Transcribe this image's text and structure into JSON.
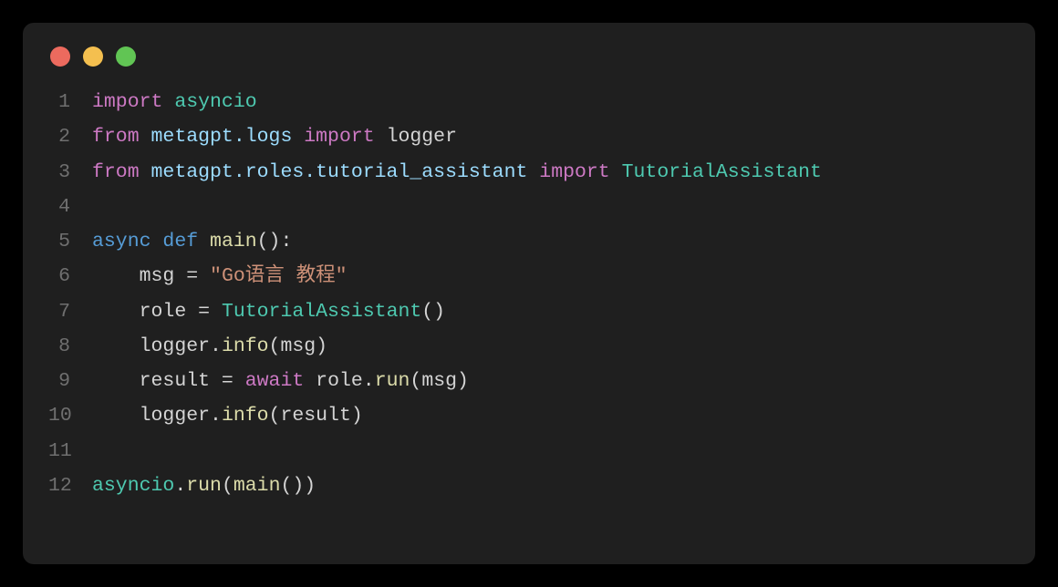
{
  "window": {
    "dots": [
      "red",
      "yellow",
      "green"
    ]
  },
  "code": {
    "language": "python",
    "lines": [
      {
        "num": "1",
        "tokens": [
          {
            "t": "import",
            "c": "c-kw1"
          },
          {
            "t": " ",
            "c": "c-op"
          },
          {
            "t": "asyncio",
            "c": "c-mod"
          }
        ]
      },
      {
        "num": "2",
        "tokens": [
          {
            "t": "from",
            "c": "c-kw1"
          },
          {
            "t": " ",
            "c": "c-op"
          },
          {
            "t": "metagpt.logs",
            "c": "c-mem"
          },
          {
            "t": " ",
            "c": "c-op"
          },
          {
            "t": "import",
            "c": "c-kw1"
          },
          {
            "t": " ",
            "c": "c-op"
          },
          {
            "t": "logger",
            "c": "c-var"
          }
        ]
      },
      {
        "num": "3",
        "tokens": [
          {
            "t": "from",
            "c": "c-kw1"
          },
          {
            "t": " ",
            "c": "c-op"
          },
          {
            "t": "metagpt.roles.tutorial_assistant",
            "c": "c-mem"
          },
          {
            "t": " ",
            "c": "c-op"
          },
          {
            "t": "import",
            "c": "c-kw1"
          },
          {
            "t": " ",
            "c": "c-op"
          },
          {
            "t": "TutorialAssistant",
            "c": "c-mod"
          }
        ]
      },
      {
        "num": "4",
        "tokens": []
      },
      {
        "num": "5",
        "tokens": [
          {
            "t": "async",
            "c": "c-kw2"
          },
          {
            "t": " ",
            "c": "c-op"
          },
          {
            "t": "def",
            "c": "c-kw2"
          },
          {
            "t": " ",
            "c": "c-op"
          },
          {
            "t": "main",
            "c": "c-fn"
          },
          {
            "t": "():",
            "c": "c-op"
          }
        ]
      },
      {
        "num": "6",
        "tokens": [
          {
            "t": "    ",
            "c": "c-op"
          },
          {
            "t": "msg",
            "c": "c-var"
          },
          {
            "t": " = ",
            "c": "c-op"
          },
          {
            "t": "\"Go语言 教程\"",
            "c": "c-str"
          }
        ]
      },
      {
        "num": "7",
        "tokens": [
          {
            "t": "    ",
            "c": "c-op"
          },
          {
            "t": "role",
            "c": "c-var"
          },
          {
            "t": " = ",
            "c": "c-op"
          },
          {
            "t": "TutorialAssistant",
            "c": "c-mod"
          },
          {
            "t": "()",
            "c": "c-op"
          }
        ]
      },
      {
        "num": "8",
        "tokens": [
          {
            "t": "    ",
            "c": "c-op"
          },
          {
            "t": "logger",
            "c": "c-var"
          },
          {
            "t": ".",
            "c": "c-op"
          },
          {
            "t": "info",
            "c": "c-fn"
          },
          {
            "t": "(",
            "c": "c-op"
          },
          {
            "t": "msg",
            "c": "c-var"
          },
          {
            "t": ")",
            "c": "c-op"
          }
        ]
      },
      {
        "num": "9",
        "tokens": [
          {
            "t": "    ",
            "c": "c-op"
          },
          {
            "t": "result",
            "c": "c-var"
          },
          {
            "t": " = ",
            "c": "c-op"
          },
          {
            "t": "await",
            "c": "c-kw1"
          },
          {
            "t": " ",
            "c": "c-op"
          },
          {
            "t": "role",
            "c": "c-var"
          },
          {
            "t": ".",
            "c": "c-op"
          },
          {
            "t": "run",
            "c": "c-fn"
          },
          {
            "t": "(",
            "c": "c-op"
          },
          {
            "t": "msg",
            "c": "c-var"
          },
          {
            "t": ")",
            "c": "c-op"
          }
        ]
      },
      {
        "num": "10",
        "tokens": [
          {
            "t": "    ",
            "c": "c-op"
          },
          {
            "t": "logger",
            "c": "c-var"
          },
          {
            "t": ".",
            "c": "c-op"
          },
          {
            "t": "info",
            "c": "c-fn"
          },
          {
            "t": "(",
            "c": "c-op"
          },
          {
            "t": "result",
            "c": "c-var"
          },
          {
            "t": ")",
            "c": "c-op"
          }
        ]
      },
      {
        "num": "11",
        "tokens": []
      },
      {
        "num": "12",
        "tokens": [
          {
            "t": "asyncio",
            "c": "c-mod"
          },
          {
            "t": ".",
            "c": "c-op"
          },
          {
            "t": "run",
            "c": "c-fn"
          },
          {
            "t": "(",
            "c": "c-op"
          },
          {
            "t": "main",
            "c": "c-fn"
          },
          {
            "t": "())",
            "c": "c-op"
          }
        ]
      }
    ]
  }
}
